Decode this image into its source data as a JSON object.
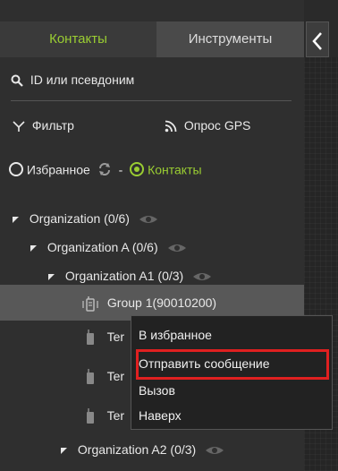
{
  "tabs": {
    "contacts": "Контакты",
    "tools": "Инструменты"
  },
  "collapse_icon": "chevron-left-icon",
  "search": {
    "placeholder": "ID или псевдоним"
  },
  "filters": {
    "filter_label": "Фильтр",
    "gps_label": "Опрос GPS"
  },
  "modes": {
    "favorites_label": "Избранное",
    "separator": "-",
    "contacts_label": "Контакты"
  },
  "tree": {
    "org_root": "Organization (0/6)",
    "org_a": "Organization A (0/6)",
    "org_a1": "Organization A1 (0/3)",
    "group1": "Group 1(90010200)",
    "term1": "Ter",
    "term2": "Ter",
    "term3": "Ter",
    "org_a2": "Organization A2 (0/3)"
  },
  "context_menu": {
    "add_favorite": "В избранное",
    "send_message": "Отправить сообщение",
    "call": "Вызов",
    "top": "Наверх"
  },
  "colors": {
    "accent": "#9acd32",
    "highlight": "#e02020"
  }
}
